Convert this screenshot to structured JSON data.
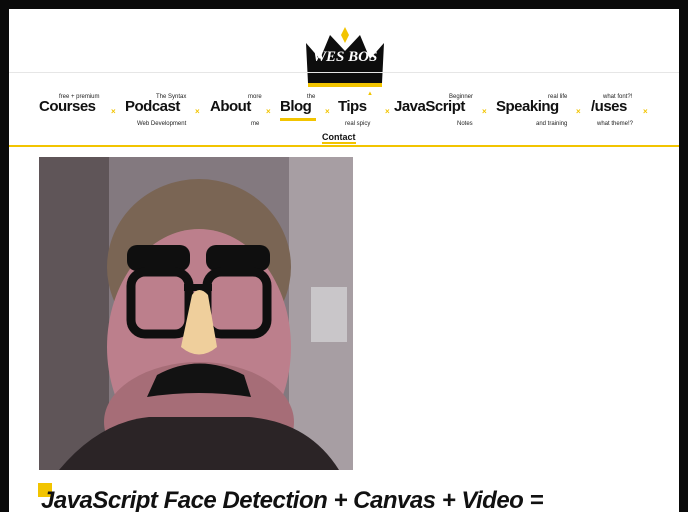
{
  "logo": {
    "text": "WES BOS"
  },
  "nav": {
    "items": [
      {
        "label": "Courses",
        "top_note": "free + premium",
        "bottom_note": ""
      },
      {
        "label": "Podcast",
        "top_note": "The Syntax",
        "bottom_note": "Web Development"
      },
      {
        "label": "About",
        "top_note": "more",
        "bottom_note": "me"
      },
      {
        "label": "Blog",
        "top_note": "the",
        "bottom_note": ""
      },
      {
        "label": "Tips",
        "top_note": "",
        "bottom_note": "real spicy"
      },
      {
        "label": "JavaScript",
        "top_note": "Beginner",
        "bottom_note": "Notes"
      },
      {
        "label": "Speaking",
        "top_note": "real life",
        "bottom_note": "and training"
      },
      {
        "label": "/uses",
        "top_note": "what font?!",
        "bottom_note": "what theme!?"
      }
    ],
    "separator": "×",
    "contact_label": "Contact"
  },
  "post": {
    "title": "JavaScript Face Detection + Canvas + Video ="
  },
  "colors": {
    "accent": "#f2c400",
    "frame": "#0a0a0a"
  }
}
